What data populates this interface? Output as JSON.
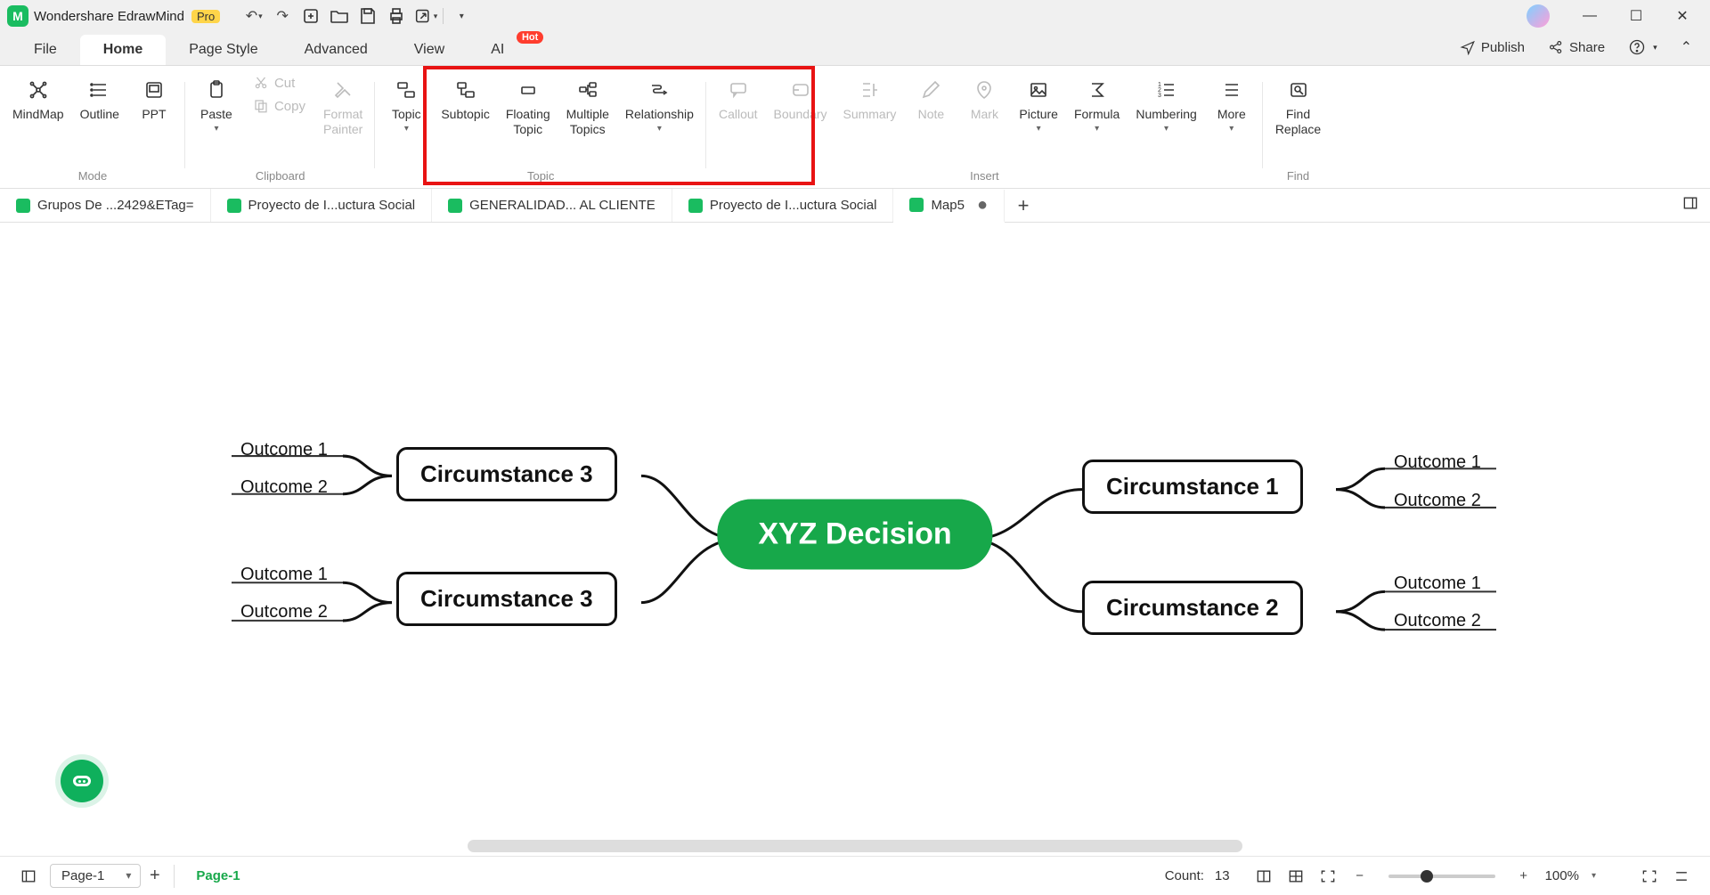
{
  "app": {
    "name": "Wondershare EdrawMind",
    "badge": "Pro"
  },
  "menu": {
    "tabs": [
      "File",
      "Home",
      "Page Style",
      "Advanced",
      "View",
      "AI"
    ],
    "active": 1,
    "hot_label": "Hot"
  },
  "titlebar_actions": {
    "publish": "Publish",
    "share": "Share"
  },
  "ribbon": {
    "mode": {
      "label": "Mode",
      "mindmap": "MindMap",
      "outline": "Outline",
      "ppt": "PPT"
    },
    "clipboard": {
      "label": "Clipboard",
      "paste": "Paste",
      "cut": "Cut",
      "copy": "Copy",
      "format_painter": "Format\nPainter"
    },
    "topic": {
      "label": "Topic",
      "topic": "Topic",
      "subtopic": "Subtopic",
      "floating": "Floating\nTopic",
      "multiple": "Multiple\nTopics",
      "relationship": "Relationship"
    },
    "insert": {
      "label": "Insert",
      "callout": "Callout",
      "boundary": "Boundary",
      "summary": "Summary",
      "note": "Note",
      "mark": "Mark",
      "picture": "Picture",
      "formula": "Formula",
      "numbering": "Numbering",
      "more": "More"
    },
    "find": {
      "label": "Find",
      "find_replace": "Find\nReplace"
    }
  },
  "doctabs": {
    "items": [
      "Grupos De ...2429&ETag=",
      "Proyecto de I...uctura Social",
      "GENERALIDAD... AL CLIENTE",
      "Proyecto de I...uctura Social",
      "Map5"
    ],
    "active": 4
  },
  "mindmap": {
    "central": "XYZ Decision",
    "right_top": {
      "title": "Circumstance 1",
      "out1": "Outcome 1",
      "out2": "Outcome 2"
    },
    "right_bot": {
      "title": "Circumstance 2",
      "out1": "Outcome 1",
      "out2": "Outcome 2"
    },
    "left_top": {
      "title": "Circumstance 3",
      "out1": "Outcome 1",
      "out2": "Outcome 2"
    },
    "left_bot": {
      "title": "Circumstance 3",
      "out1": "Outcome 1",
      "out2": "Outcome 2"
    }
  },
  "pages": {
    "selector": "Page-1",
    "active": "Page-1"
  },
  "status": {
    "count_label": "Count:",
    "count_value": "13",
    "zoom": "100%"
  }
}
